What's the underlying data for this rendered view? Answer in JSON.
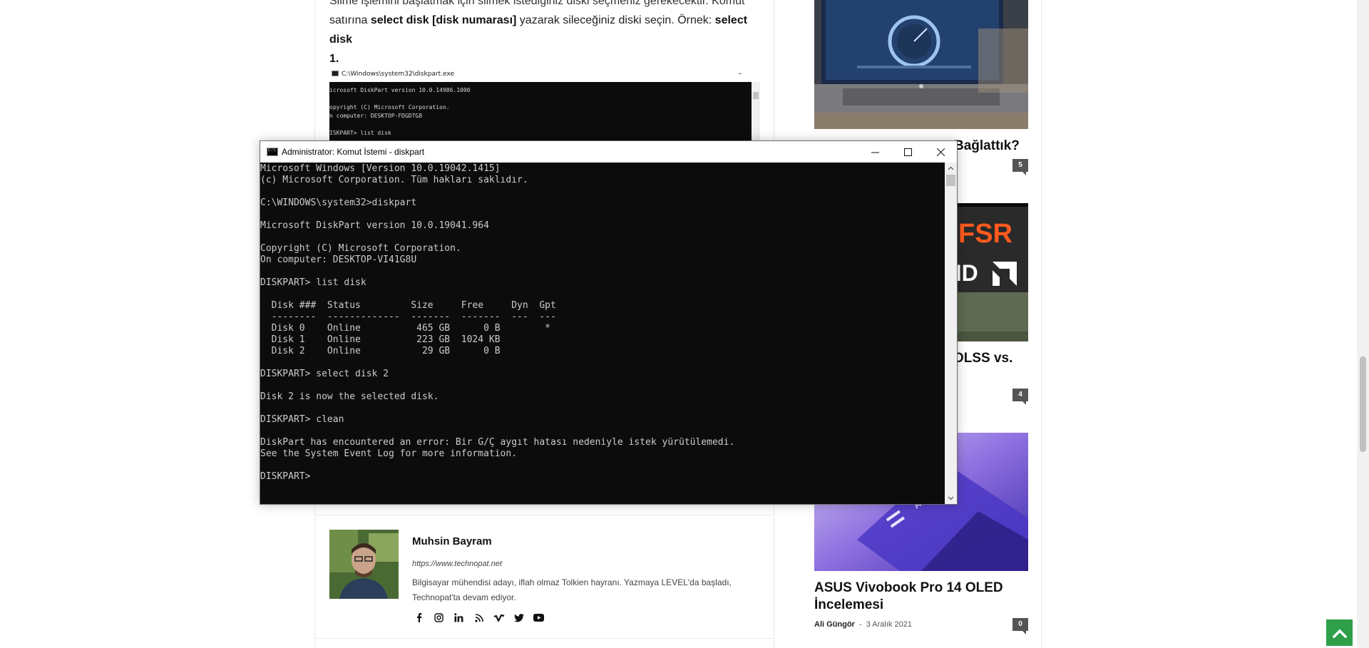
{
  "article": {
    "paragraph": {
      "line1": "Silme işlemini başlatmak için silmek istediğiniz diski seçmeniz gerekecektir. Komut",
      "line2_pre": "satırına ",
      "line2_bold": "select disk [disk numarası]",
      "line2_post": " yazarak sileceğiniz diski seçin. Örnek: ",
      "line2_bold2": "select disk",
      "line3_bold": "1."
    },
    "embedded_screenshot": {
      "title": "C:\\Windows\\system32\\diskpart.exe",
      "console": "icrosoft DiskPart version 10.0.14986.1000\n\nopyright (C) Microsoft Corporation.\nn computer: DESKTOP-FDGDTG8\n\nISKPART> list disk"
    }
  },
  "cmd_window": {
    "title": "Administrator: Komut İstemi - diskpart",
    "minimize_label": "—",
    "maximize_label": "☐",
    "close_label": "✕",
    "console_lines": [
      "Microsoft Windows [Version 10.0.19042.1415]",
      "(c) Microsoft Corporation. Tüm hakları saklıdır.",
      "",
      "C:\\WINDOWS\\system32>diskpart",
      "",
      "Microsoft DiskPart version 10.0.19041.964",
      "",
      "Copyright (C) Microsoft Corporation.",
      "On computer: DESKTOP-VI41G8U",
      "",
      "DISKPART> list disk",
      "",
      "  Disk ###  Status         Size     Free     Dyn  Gpt",
      "  --------  -------------  -------  -------  ---  ---",
      "  Disk 0    Online          465 GB      0 B        *",
      "  Disk 1    Online          223 GB  1024 KB",
      "  Disk 2    Online           29 GB      0 B",
      "",
      "DISKPART> select disk 2",
      "",
      "Disk 2 is now the selected disk.",
      "",
      "DISKPART> clean",
      "",
      "DiskPart has encountered an error: Bir G/Ç aygıt hatası nedeniyle istek yürütülemedi.",
      "See the System Event Log for more information.",
      "",
      "DISKPART>"
    ]
  },
  "author": {
    "name": "Muhsin Bayram",
    "url": "https://www.technopat.net",
    "bio": "Bilgisayar mühendisi adayı, iflah olmaz Tolkien hayranı. Yazmaya LEVEL'da başladı, Technopat'ta devam ediyor.",
    "social": [
      "facebook-icon",
      "instagram-icon",
      "linkedin-icon",
      "rss-icon",
      "vimeo-icon",
      "twitter-icon",
      "youtube-icon"
    ]
  },
  "sidebar": {
    "posts": [
      {
        "title_visible": "Bağlattık?",
        "comments": "5"
      },
      {
        "title_visible": "DLSS vs.",
        "comments": "4",
        "image_text": "FSR",
        "image_text2": "MD"
      },
      {
        "title": "ASUS Vivobook Pro 14 OLED İncelemesi",
        "author": "Ali Güngör",
        "date": "3 Aralık 2021",
        "comments": "0",
        "image_text": "ASU"
      }
    ]
  },
  "colors": {
    "console_bg": "#0c0c0c",
    "console_fg": "#cccccc",
    "back_to_top": "#2fa04a",
    "badge": "#555555"
  }
}
